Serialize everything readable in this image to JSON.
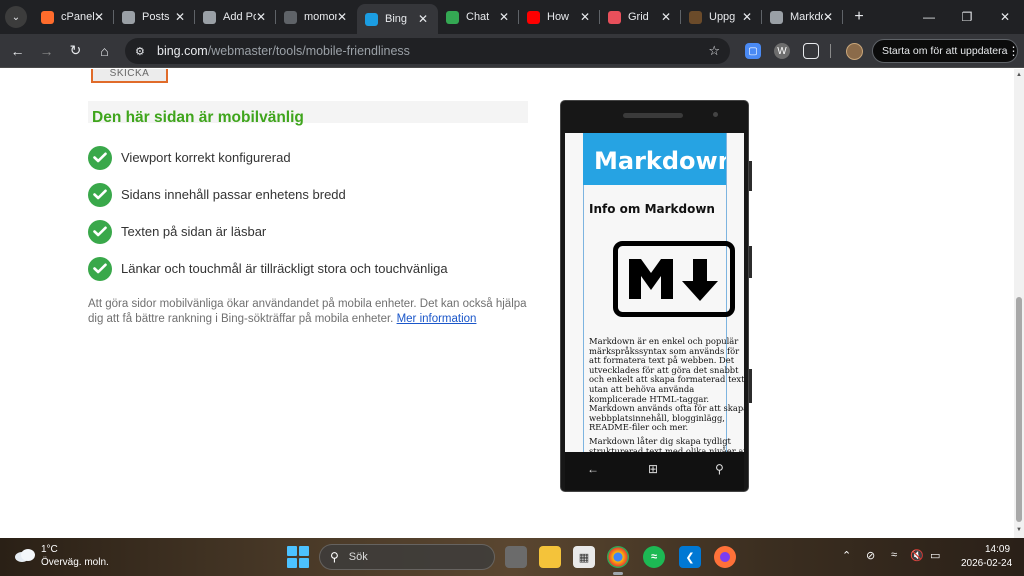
{
  "browser": {
    "tabs": [
      {
        "title": "cPanel",
        "icon": "cpanel-icon",
        "color": "#ff6c2c"
      },
      {
        "title": "Posts",
        "icon": "globe-icon",
        "color": "#9aa0a6"
      },
      {
        "title": "Add Post",
        "icon": "globe-icon",
        "color": "#9aa0a6"
      },
      {
        "title": "momondo",
        "icon": "momondo-icon",
        "color": "#5f6368"
      },
      {
        "title": "Bing",
        "icon": "bing-icon",
        "color": "#1b9de2",
        "active": true
      },
      {
        "title": "Chat",
        "icon": "chat-icon",
        "color": "#34a853"
      },
      {
        "title": "How",
        "icon": "youtube-icon",
        "color": "#ff0000"
      },
      {
        "title": "Grid",
        "icon": "grid-icon",
        "color": "#e8505b"
      },
      {
        "title": "Uppg",
        "icon": "uppg-icon",
        "color": "#6b4b2a"
      },
      {
        "title": "Markdown",
        "icon": "globe-icon",
        "color": "#9aa0a6"
      }
    ],
    "url_domain": "bing.com",
    "url_path": "/webmaster/tools/mobile-friendliness",
    "update_label": "Starta om för att uppdatera"
  },
  "page": {
    "check_button": "SKICKA",
    "result_title": "Den här sidan är mobilvänlig",
    "checks": [
      "Viewport korrekt konfigurerad",
      "Sidans innehåll passar enhetens bredd",
      "Texten på sidan är läsbar",
      "Länkar och touchmål är tillräckligt stora och touchvänliga"
    ],
    "info_text": "Att göra sidor mobilvänliga ökar användandet på mobila enheter. Det kan också hjälpa dig att få bättre rankning i Bing-sökträffar på mobila enheter.",
    "info_link": "Mer information"
  },
  "phone_preview": {
    "header": "Markdown",
    "subheading": "Info om Markdown",
    "paragraph1": "Markdown är en enkel och populär märkspråkssyntax som används för att formatera text på webben. Det utvecklades för att göra det snabbt och enkelt att skapa formaterad text utan att behöva använda komplicerade HTML-taggar. Markdown används ofta för att skapa webbplatsinnehåll, blogginlägg, README-filer och mer.",
    "paragraph2": "Markdown låter dig skapa tydligt strukturerad text med olika nivåer av"
  },
  "taskbar": {
    "temperature": "1°C",
    "weather": "Överväg. moln.",
    "search_placeholder": "Sök",
    "time": "14:09",
    "date": "2026-02-24"
  },
  "colors": {
    "success_green": "#3fa51c",
    "check_green": "#39a84a",
    "link_blue": "#1a56c9",
    "markdown_blue": "#26a3e3"
  }
}
